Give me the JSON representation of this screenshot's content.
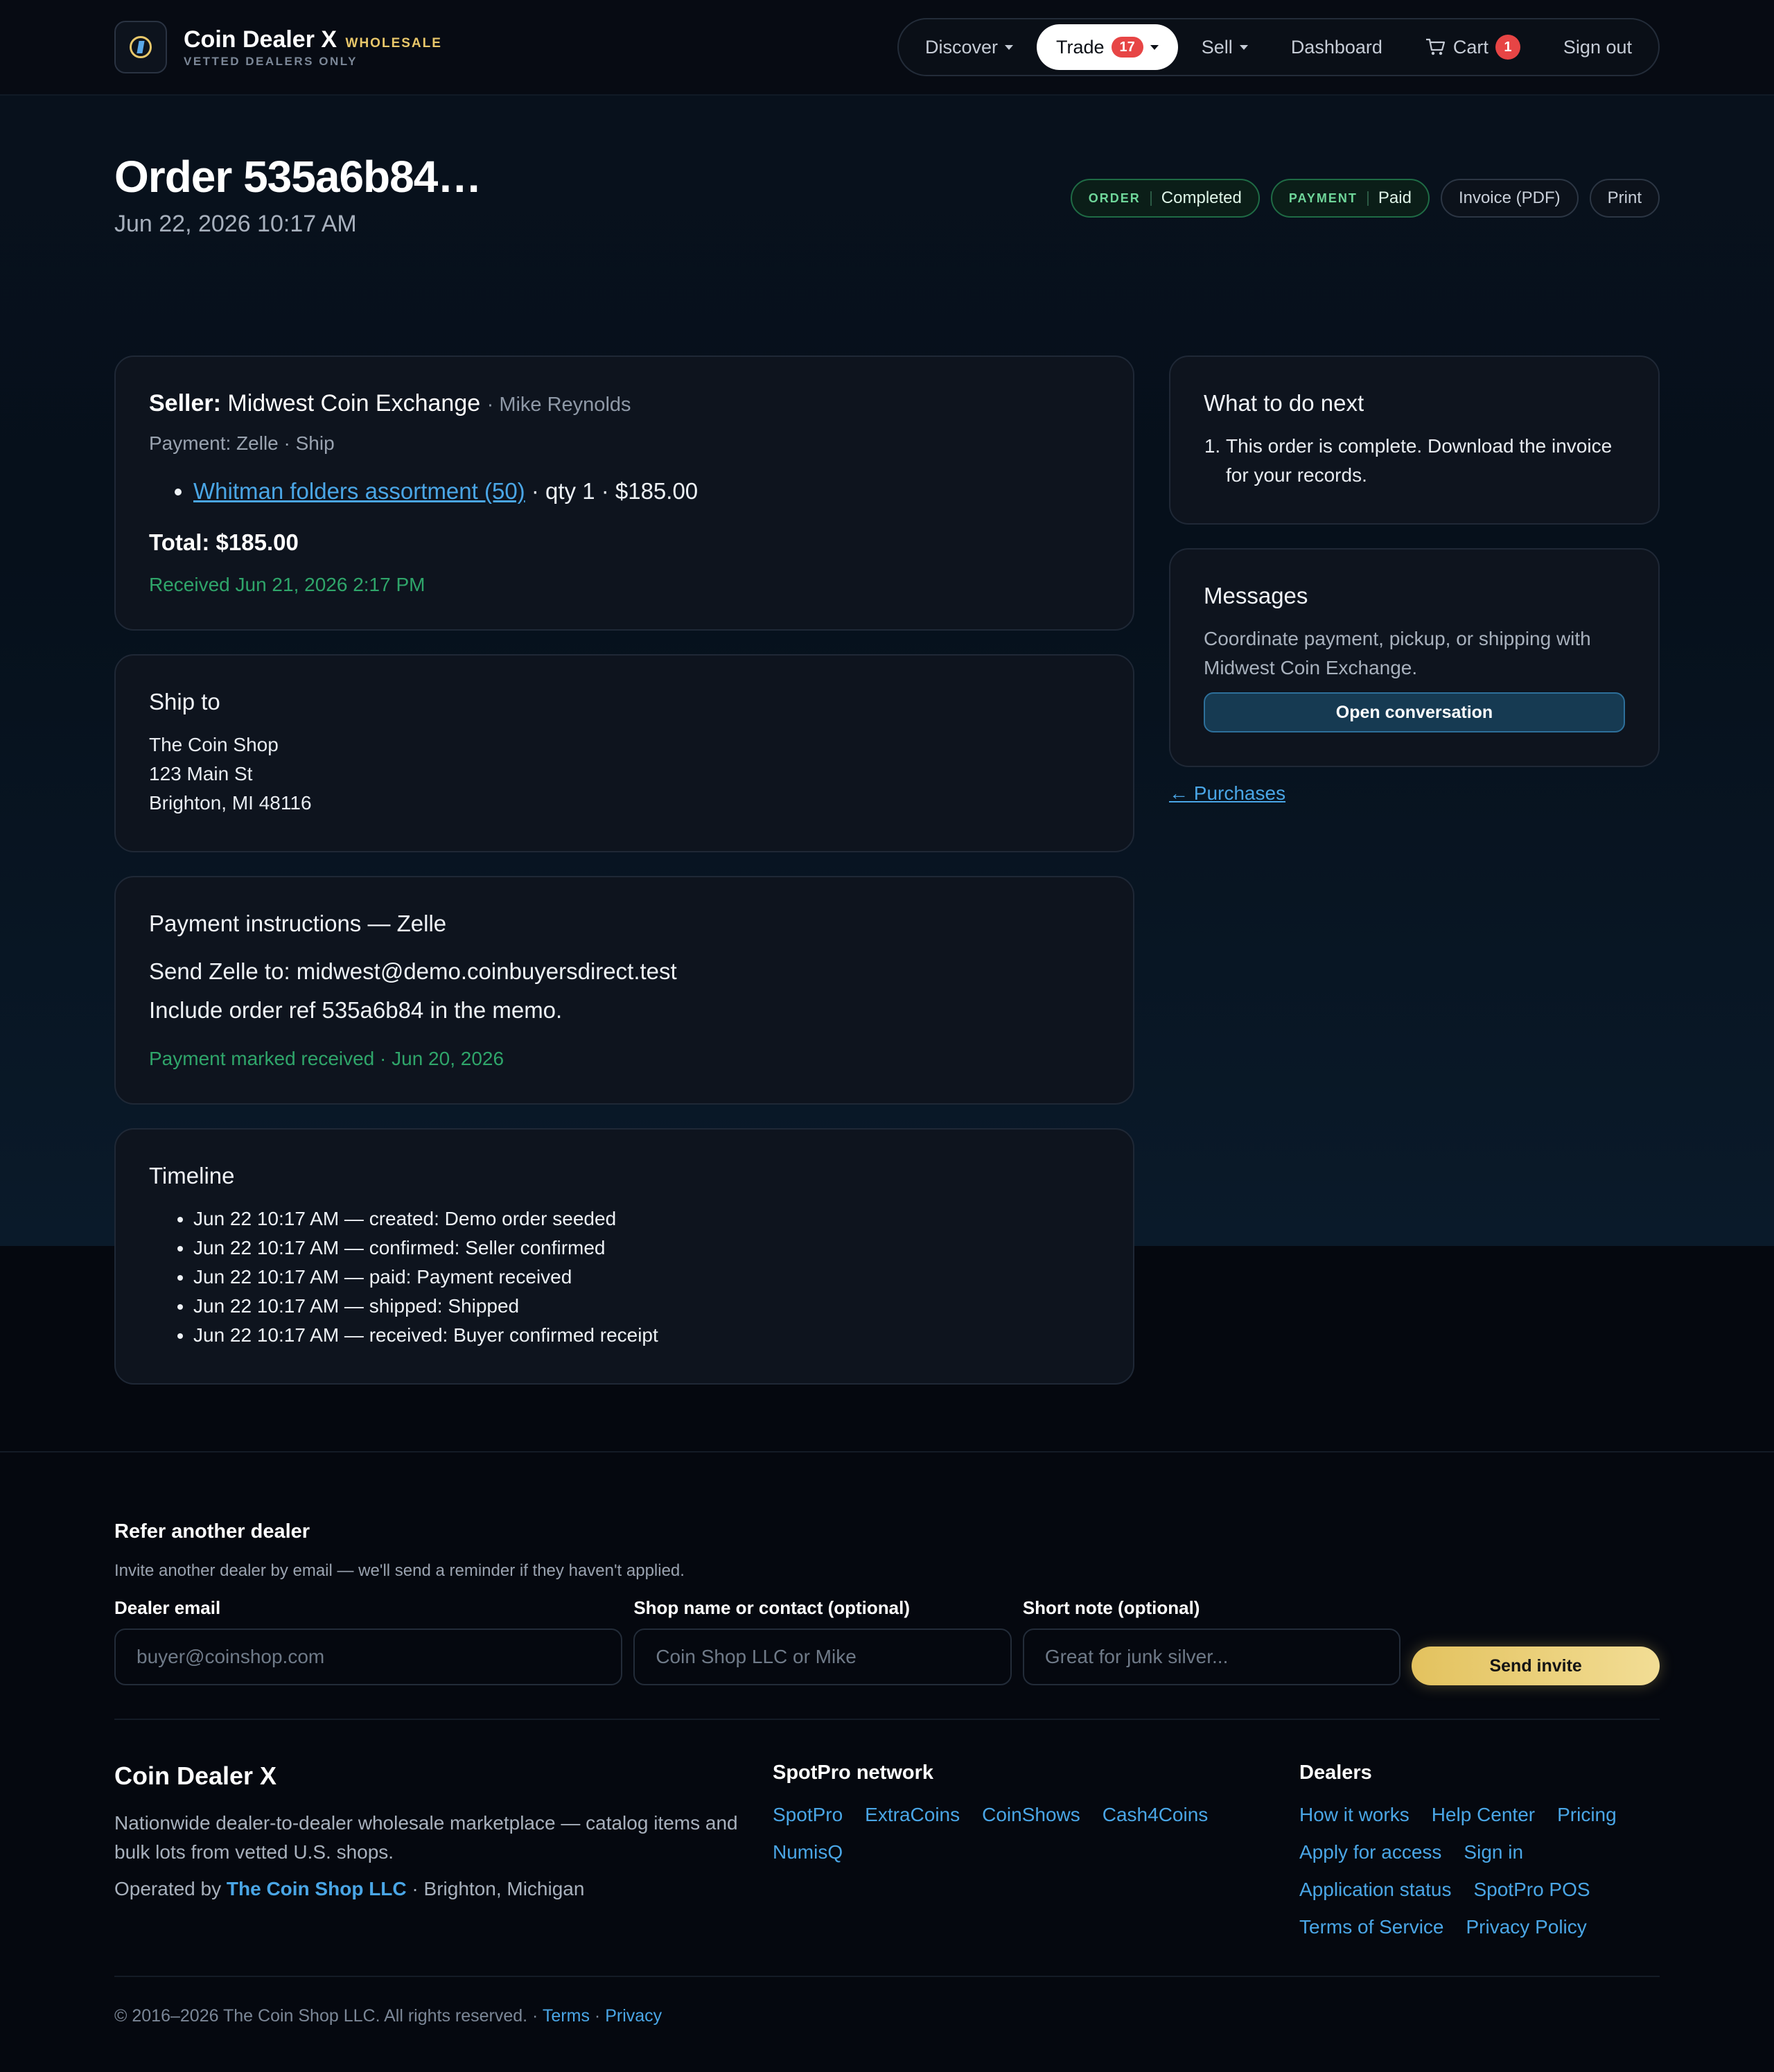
{
  "header": {
    "brand_name": "Coin Dealer X",
    "brand_tag": "WHOLESALE",
    "brand_sub": "VETTED DEALERS ONLY",
    "nav": {
      "discover": "Discover",
      "trade": "Trade",
      "trade_badge": "17",
      "sell": "Sell",
      "dashboard": "Dashboard",
      "cart": "Cart",
      "cart_badge": "1",
      "signout": "Sign out"
    }
  },
  "order": {
    "title": "Order 535a6b84…",
    "date": "Jun 22, 2026 10:17 AM",
    "order_label": "ORDER",
    "order_status": "Completed",
    "payment_label": "PAYMENT",
    "payment_status": "Paid",
    "invoice_button": "Invoice (PDF)",
    "print_button": "Print"
  },
  "seller_card": {
    "seller_label": "Seller:",
    "seller_name": "Midwest Coin Exchange",
    "seller_contact": "· Mike Reynolds",
    "payment_line": "Payment: Zelle · Ship",
    "item_link": "Whitman folders assortment (50)",
    "item_detail": " · qty 1 · $185.00",
    "total": "Total: $185.00",
    "received": "Received Jun 21, 2026 2:17 PM"
  },
  "ship_card": {
    "title": "Ship to",
    "line1": "The Coin Shop",
    "line2": "123 Main St",
    "line3": "Brighton, MI 48116"
  },
  "payment_card": {
    "title": "Payment instructions — Zelle",
    "line1": "Send Zelle to: midwest@demo.coinbuyersdirect.test",
    "line2": "Include order ref 535a6b84 in the memo.",
    "status": "Payment marked received · Jun 20, 2026"
  },
  "timeline_card": {
    "title": "Timeline",
    "events": [
      "Jun 22 10:17 AM — created: Demo order seeded",
      "Jun 22 10:17 AM — confirmed: Seller confirmed",
      "Jun 22 10:17 AM — paid: Payment received",
      "Jun 22 10:17 AM — shipped: Shipped",
      "Jun 22 10:17 AM — received: Buyer confirmed receipt"
    ]
  },
  "next_card": {
    "title": "What to do next",
    "step1": "This order is complete. Download the invoice for your records."
  },
  "messages_card": {
    "title": "Messages",
    "text": "Coordinate payment, pickup, or shipping with Midwest Coin Exchange.",
    "button": "Open conversation"
  },
  "back_link": "← Purchases",
  "refer": {
    "title": "Refer another dealer",
    "subtitle": "Invite another dealer by email — we'll send a reminder if they haven't applied.",
    "email_label": "Dealer email",
    "email_placeholder": "buyer@coinshop.com",
    "shop_label": "Shop name or contact (optional)",
    "shop_placeholder": "Coin Shop LLC or Mike",
    "note_label": "Short note (optional)",
    "note_placeholder": "Great for junk silver...",
    "send_button": "Send invite"
  },
  "footer": {
    "brand": "Coin Dealer X",
    "description": "Nationwide dealer-to-dealer wholesale marketplace — catalog items and bulk lots from vetted U.S. shops.",
    "operated_prefix": "Operated by",
    "operated_name": "The Coin Shop LLC",
    "operated_suffix": "· Brighton, Michigan",
    "network_title": "SpotPro network",
    "network_links": [
      "SpotPro",
      "ExtraCoins",
      "CoinShows",
      "Cash4Coins",
      "NumisQ"
    ],
    "dealers_title": "Dealers",
    "dealer_links": [
      "How it works",
      "Help Center",
      "Pricing",
      "Apply for access",
      "Sign in",
      "Application status",
      "SpotPro POS",
      "Terms of Service",
      "Privacy Policy"
    ],
    "copyright": "© 2016–2026 The Coin Shop LLC. All rights reserved. ·",
    "terms": "Terms",
    "sep": "·",
    "privacy": "Privacy"
  },
  "colors": {
    "accent_blue": "#4aa6e6",
    "gold": "#e8c76a",
    "success_green": "#2fa56a",
    "badge_red": "#e74545"
  }
}
